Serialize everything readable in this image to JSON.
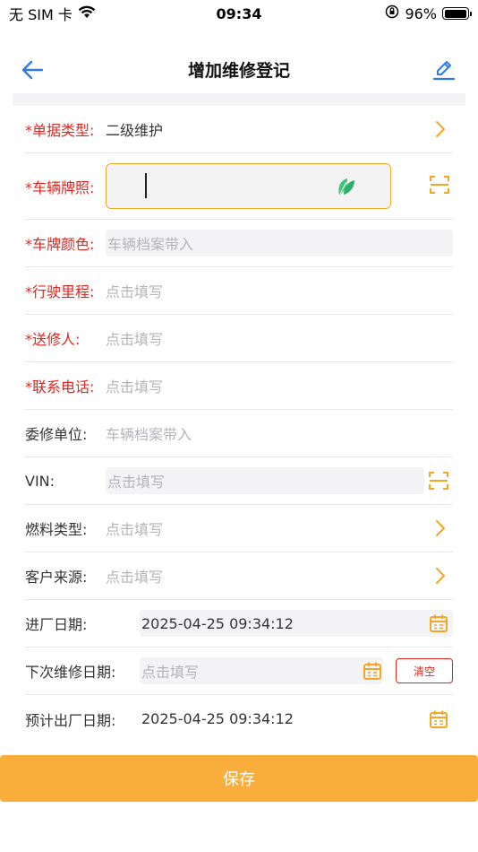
{
  "status_bar": {
    "carrier": "无 SIM 卡",
    "time": "09:34",
    "battery_percent": "96%",
    "battery_level": 0.96,
    "icons": [
      "wifi-icon",
      "orientation-lock-icon",
      "battery-icon"
    ]
  },
  "nav": {
    "title": "增加维修登记",
    "back_icon": "arrow-left-icon",
    "edit_icon": "pencil-icon"
  },
  "form": {
    "doc_type": {
      "label": "*单据类型:",
      "value": "二级维护"
    },
    "plate": {
      "label": "*车辆牌照:",
      "value": ""
    },
    "plate_color": {
      "label": "*车牌颜色:",
      "placeholder": "车辆档案带入"
    },
    "mileage": {
      "label": "*行驶里程:",
      "placeholder": "点击填写"
    },
    "sender": {
      "label": "*送修人:",
      "placeholder": "点击填写"
    },
    "phone": {
      "label": "*联系电话:",
      "placeholder": "点击填写"
    },
    "unit": {
      "label": "委修单位:",
      "placeholder": "车辆档案带入"
    },
    "vin": {
      "label": "VIN:",
      "placeholder": "点击填写"
    },
    "fuel": {
      "label": "燃料类型:",
      "placeholder": "点击填写"
    },
    "source": {
      "label": "客户来源:",
      "placeholder": "点击填写"
    },
    "entry_date": {
      "label": "进厂日期:",
      "value": "2025-04-25 09:34:12"
    },
    "next_date": {
      "label": "下次维修日期:",
      "placeholder": "点击填写",
      "clear": "清空"
    },
    "exit_date": {
      "label": "预计出厂日期:",
      "value": "2025-04-25 09:34:12"
    }
  },
  "save_label": "保存",
  "colors": {
    "accent_blue": "#2f7be6",
    "accent_orange": "#f5a623",
    "required_red": "#e0261f",
    "save_button": "#f9ae3c",
    "leaf_green": "#3cc47a"
  }
}
